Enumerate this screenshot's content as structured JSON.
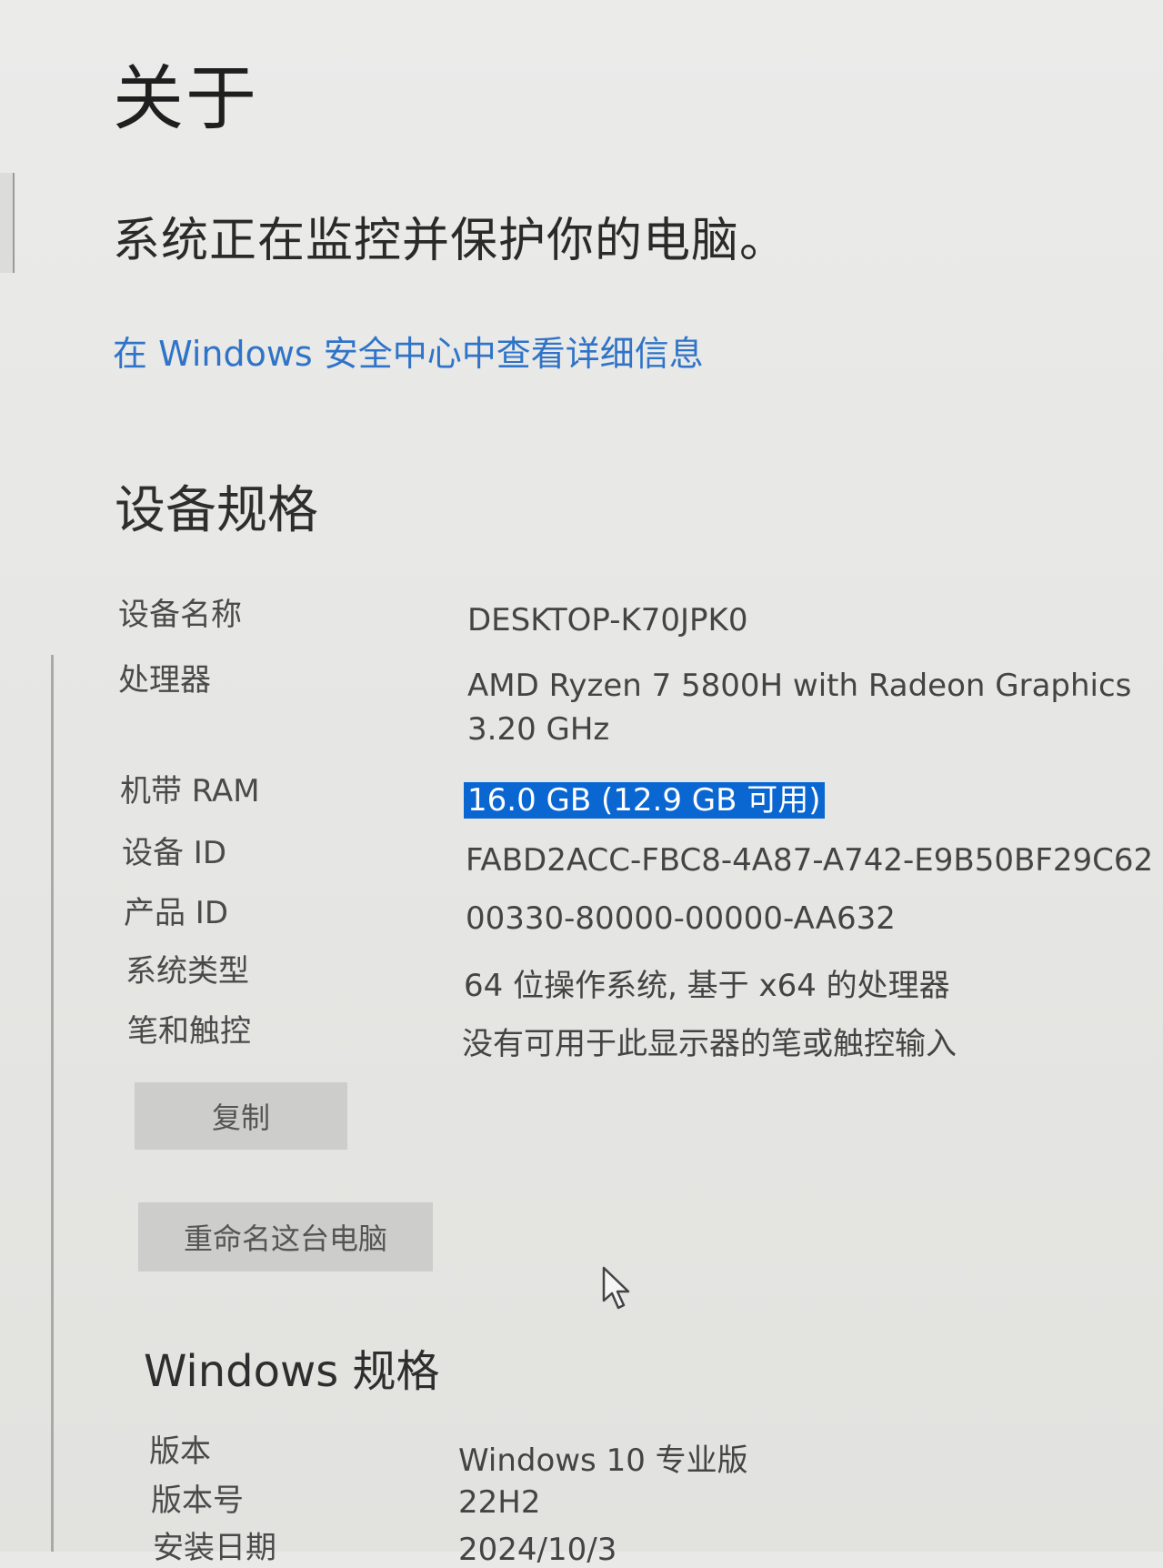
{
  "page": {
    "title": "关于",
    "protection_text": "系统正在监控并保护你的电脑。",
    "security_link": "在 Windows 安全中心中查看详细信息"
  },
  "device_specs": {
    "title": "设备规格",
    "rows": [
      {
        "label": "设备名称",
        "value": "DESKTOP-K70JPK0"
      },
      {
        "label": "处理器",
        "value": "AMD Ryzen 7 5800H with Radeon Graphics",
        "value2": "3.20 GHz"
      },
      {
        "label": "机带 RAM",
        "value": "16.0 GB (12.9 GB 可用)"
      },
      {
        "label": "设备 ID",
        "value": "FABD2ACC-FBC8-4A87-A742-E9B50BF29C62"
      },
      {
        "label": "产品 ID",
        "value": "00330-80000-00000-AA632"
      },
      {
        "label": "系统类型",
        "value": "64 位操作系统, 基于 x64 的处理器"
      },
      {
        "label": "笔和触控",
        "value": "没有可用于此显示器的笔或触控输入"
      }
    ],
    "copy_button": "复制",
    "rename_button": "重命名这台电脑"
  },
  "windows_specs": {
    "title": "Windows 规格",
    "rows": [
      {
        "label": "版本",
        "value": "Windows 10 专业版"
      },
      {
        "label": "版本号",
        "value": "22H2"
      },
      {
        "label": "安装日期",
        "value": "2024/10/3"
      }
    ]
  },
  "icons": {
    "cursor": "arrow-cursor-icon"
  },
  "colors": {
    "link": "#2f74c8",
    "selection": "#0a67d2"
  }
}
